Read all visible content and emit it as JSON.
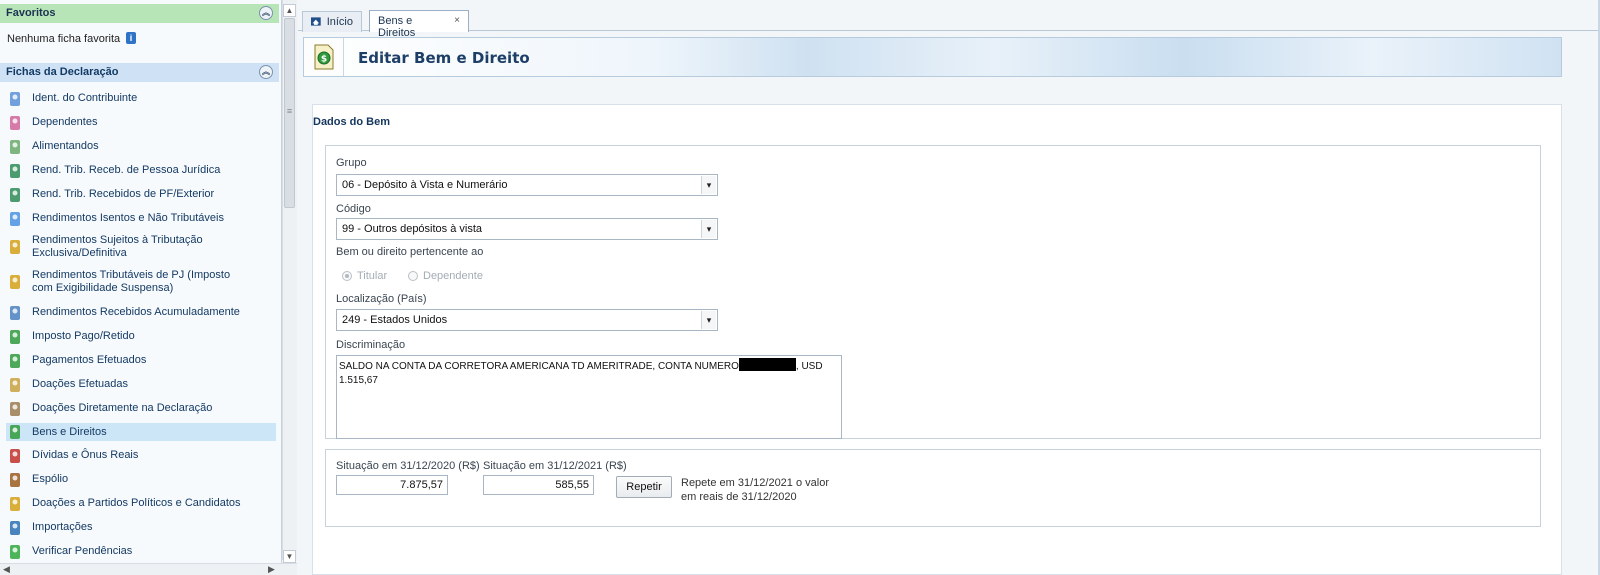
{
  "sidebar": {
    "favoritos": {
      "title": "Favoritos",
      "empty_text": "Nenhuma ficha favorita"
    },
    "fichas": {
      "title": "Fichas da Declaração"
    },
    "items": [
      {
        "label": "Ident. do Contribuinte",
        "icon": "person-icon"
      },
      {
        "label": "Dependentes",
        "icon": "dependents-icon"
      },
      {
        "label": "Alimentandos",
        "icon": "alimentandos-icon"
      },
      {
        "label": "Rend. Trib. Receb. de Pessoa Jurídica",
        "icon": "company-income-icon"
      },
      {
        "label": "Rend. Trib. Recebidos de PF/Exterior",
        "icon": "pf-income-icon"
      },
      {
        "label": "Rendimentos Isentos e Não Tributáveis",
        "icon": "exempt-income-icon"
      },
      {
        "label": "Rendimentos Sujeitos à Tributação Exclusiva/Definitiva",
        "icon": "exclusive-tax-icon"
      },
      {
        "label": "Rendimentos Tributáveis de PJ (Imposto com Exigibilidade Suspensa)",
        "icon": "suspended-tax-icon"
      },
      {
        "label": "Rendimentos Recebidos Acumuladamente",
        "icon": "accumulated-income-icon"
      },
      {
        "label": "Imposto Pago/Retido",
        "icon": "tax-paid-icon"
      },
      {
        "label": "Pagamentos Efetuados",
        "icon": "payments-icon"
      },
      {
        "label": "Doações Efetuadas",
        "icon": "donations-icon"
      },
      {
        "label": "Doações Diretamente na Declaração",
        "icon": "direct-donations-icon"
      },
      {
        "label": "Bens e Direitos",
        "icon": "assets-icon"
      },
      {
        "label": "Dívidas e Ônus Reais",
        "icon": "debts-icon"
      },
      {
        "label": "Espólio",
        "icon": "estate-icon"
      },
      {
        "label": "Doações a Partidos Políticos e Candidatos",
        "icon": "political-donations-icon"
      },
      {
        "label": "Importações",
        "icon": "imports-icon"
      },
      {
        "label": "Verificar Pendências",
        "icon": "check-icon"
      }
    ]
  },
  "tabs": [
    {
      "label": "Início"
    },
    {
      "label": "Bens e Direitos",
      "close": "×"
    }
  ],
  "page": {
    "title": "Editar Bem e Direito"
  },
  "form": {
    "section_title": "Dados do Bem",
    "grupo": {
      "label": "Grupo",
      "value": "06 - Depósito à Vista e Numerário"
    },
    "codigo": {
      "label": "Código",
      "value": "99 - Outros depósitos à vista"
    },
    "pertencente": {
      "label": "Bem ou direito pertencente ao",
      "options": [
        "Titular",
        "Dependente"
      ],
      "selected": "Titular"
    },
    "localizacao": {
      "label": "Localização (País)",
      "value": "249 - Estados Unidos"
    },
    "discriminacao": {
      "label": "Discriminação",
      "text_before": "SALDO NA CONTA DA CORRETORA AMERICANA TD AMERITRADE, CONTA NUMERO",
      "text_after": ", USD 1.515,67"
    },
    "situacao_2020": {
      "label": "Situação em 31/12/2020 (R$)",
      "value": "7.875,57"
    },
    "situacao_2021": {
      "label": "Situação em 31/12/2021 (R$)",
      "value": "585,55"
    },
    "repetir": {
      "label": "Repetir",
      "help": "Repete em 31/12/2021 o valor em reais de 31/12/2020"
    }
  },
  "colors": {
    "favoritos_header": "#b8e5b8",
    "fichas_header": "#cfe2f5",
    "selected_item": "#cde6f7",
    "title": "#1d3e66"
  }
}
